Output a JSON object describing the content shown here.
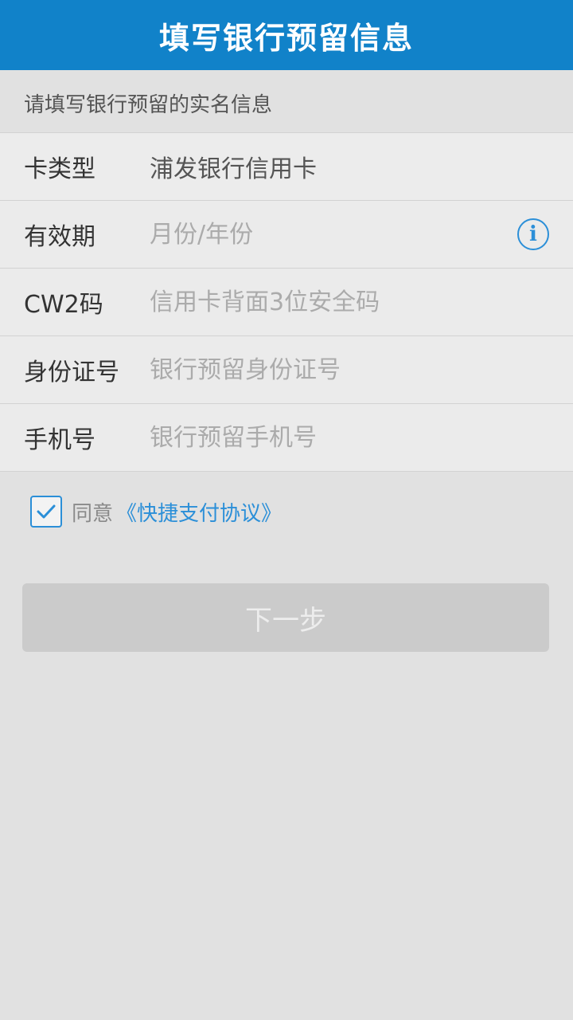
{
  "header": {
    "title": "填写银行预留信息"
  },
  "subtitle": "请填写银行预留的实名信息",
  "form": {
    "card_type": {
      "label": "卡类型",
      "value": "浦发银行信用卡"
    },
    "expiry": {
      "label": "有效期",
      "placeholder": "月份/年份",
      "icon": "info-icon"
    },
    "cvv": {
      "label": "CW2码",
      "placeholder": "信用卡背面3位安全码"
    },
    "id_number": {
      "label": "身份证号",
      "placeholder": "银行预留身份证号"
    },
    "phone": {
      "label": "手机号",
      "placeholder": "银行预留手机号"
    }
  },
  "agreement": {
    "checked": true,
    "text": "同意",
    "link": "《快捷支付协议》"
  },
  "next_button": {
    "label": "下一步"
  },
  "colors": {
    "header_bg": "#1182c9",
    "accent": "#2b8fd8",
    "page_bg": "#e1e1e1",
    "button_disabled_bg": "#cbcbcb"
  }
}
